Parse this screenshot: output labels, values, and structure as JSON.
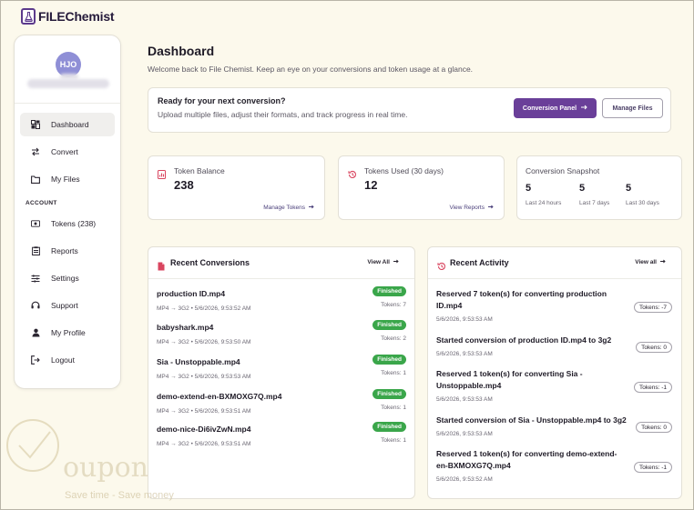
{
  "app": {
    "name": "FILEChemist"
  },
  "user": {
    "initials": "HJO"
  },
  "sidebar": {
    "items": [
      {
        "label": "Dashboard",
        "icon": "dashboard-icon"
      },
      {
        "label": "Convert",
        "icon": "convert-arrows-icon"
      },
      {
        "label": "My Files",
        "icon": "folder-icon"
      }
    ],
    "section": "ACCOUNT",
    "account_items": [
      {
        "label": "Tokens (238)",
        "icon": "tokens-icon"
      },
      {
        "label": "Reports",
        "icon": "clipboard-icon"
      },
      {
        "label": "Settings",
        "icon": "sliders-icon"
      },
      {
        "label": "Support",
        "icon": "headset-icon"
      },
      {
        "label": "My Profile",
        "icon": "user-icon"
      },
      {
        "label": "Logout",
        "icon": "logout-icon"
      }
    ]
  },
  "header": {
    "title": "Dashboard",
    "subtitle": "Welcome back to File Chemist. Keep an eye on your conversions and token usage at a glance."
  },
  "cta": {
    "title": "Ready for your next conversion?",
    "subtitle": "Upload multiple files, adjust their formats, and track progress in real time.",
    "primary_label": "Conversion Panel",
    "secondary_label": "Manage Files"
  },
  "stats": {
    "balance": {
      "label": "Token Balance",
      "value": "238",
      "link": "Manage Tokens"
    },
    "used": {
      "label": "Tokens Used (30 days)",
      "value": "12",
      "link": "View Reports"
    },
    "snapshot": {
      "label": "Conversion Snapshot",
      "cols": [
        {
          "value": "5",
          "label": "Last 24 hours"
        },
        {
          "value": "5",
          "label": "Last 7 days"
        },
        {
          "value": "5",
          "label": "Last 30 days"
        }
      ]
    }
  },
  "recent_conversions": {
    "title": "Recent Conversions",
    "link": "View All",
    "items": [
      {
        "name": "production ID.mp4",
        "meta": "MP4 → 3G2 • 5/6/2026, 9:53:52 AM",
        "status": "Finished",
        "tokens": "Tokens: 7"
      },
      {
        "name": "babyshark.mp4",
        "meta": "MP4 → 3G2 • 5/6/2026, 9:53:50 AM",
        "status": "Finished",
        "tokens": "Tokens: 2"
      },
      {
        "name": "Sia - Unstoppable.mp4",
        "meta": "MP4 → 3G2 • 5/6/2026, 9:53:53 AM",
        "status": "Finished",
        "tokens": "Tokens: 1"
      },
      {
        "name": "demo-extend-en-BXMOXG7Q.mp4",
        "meta": "MP4 → 3G2 • 5/6/2026, 9:53:51 AM",
        "status": "Finished",
        "tokens": "Tokens: 1"
      },
      {
        "name": "demo-nice-Di6ivZwN.mp4",
        "meta": "MP4 → 3G2 • 5/6/2026, 9:53:51 AM",
        "status": "Finished",
        "tokens": "Tokens: 1"
      }
    ]
  },
  "recent_activity": {
    "title": "Recent Activity",
    "link": "View all",
    "items": [
      {
        "text": "Reserved 7 token(s) for converting production ID.mp4",
        "time": "5/6/2026, 9:53:53 AM",
        "tokens": "Tokens: -7"
      },
      {
        "text": "Started conversion of production ID.mp4 to 3g2",
        "time": "5/6/2026, 9:53:53 AM",
        "tokens": "Tokens: 0"
      },
      {
        "text": "Reserved 1 token(s) for converting Sia - Unstoppable.mp4",
        "time": "5/6/2026, 9:53:53 AM",
        "tokens": "Tokens: -1"
      },
      {
        "text": "Started conversion of Sia - Unstoppable.mp4 to 3g2",
        "time": "5/6/2026, 9:53:53 AM",
        "tokens": "Tokens: 0"
      },
      {
        "text": "Reserved 1 token(s) for converting demo-extend-en-BXMOXG7Q.mp4",
        "time": "5/6/2026, 9:53:52 AM",
        "tokens": "Tokens: -1"
      }
    ]
  },
  "watermark": {
    "word": "oupon",
    "tagline": "Save time - Save money"
  },
  "colors": {
    "accent": "#6a3f99",
    "success": "#3aa64a",
    "background": "#fcf9ec",
    "danger_icon": "#d9455f"
  }
}
